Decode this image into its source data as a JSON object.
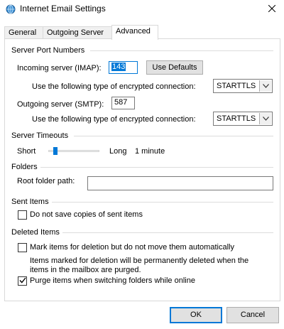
{
  "window": {
    "title": "Internet Email Settings"
  },
  "tabs": [
    {
      "label": "General"
    },
    {
      "label": "Outgoing Server"
    },
    {
      "label": "Advanced"
    }
  ],
  "active_tab": "Advanced",
  "server_ports": {
    "group_label": "Server Port Numbers",
    "incoming_label": "Incoming server (IMAP):",
    "incoming_value": "143",
    "use_defaults_label": "Use Defaults",
    "incoming_encryption_label": "Use the following type of encrypted connection:",
    "incoming_encryption_value": "STARTTLS",
    "outgoing_label": "Outgoing server (SMTP):",
    "outgoing_value": "587",
    "outgoing_encryption_label": "Use the following type of encrypted connection:",
    "outgoing_encryption_value": "STARTTLS"
  },
  "timeouts": {
    "group_label": "Server Timeouts",
    "short_label": "Short",
    "long_label": "Long",
    "value_text": "1 minute",
    "slider_level": 0.1
  },
  "folders": {
    "group_label": "Folders",
    "root_label": "Root folder path:",
    "root_value": ""
  },
  "sent_items": {
    "group_label": "Sent Items",
    "no_save_label": "Do not save copies of sent items",
    "no_save_checked": false
  },
  "deleted_items": {
    "group_label": "Deleted Items",
    "mark_label": "Mark items for deletion but do not move them automatically",
    "mark_checked": false,
    "note_line1": "Items marked for deletion will be permanently deleted when the",
    "note_line2": "items in the mailbox are purged.",
    "purge_label": "Purge items when switching folders while online",
    "purge_checked": true
  },
  "footer": {
    "ok_label": "OK",
    "cancel_label": "Cancel"
  },
  "colors": {
    "accent": "#0078d7",
    "button_face": "#e1e1e1"
  }
}
